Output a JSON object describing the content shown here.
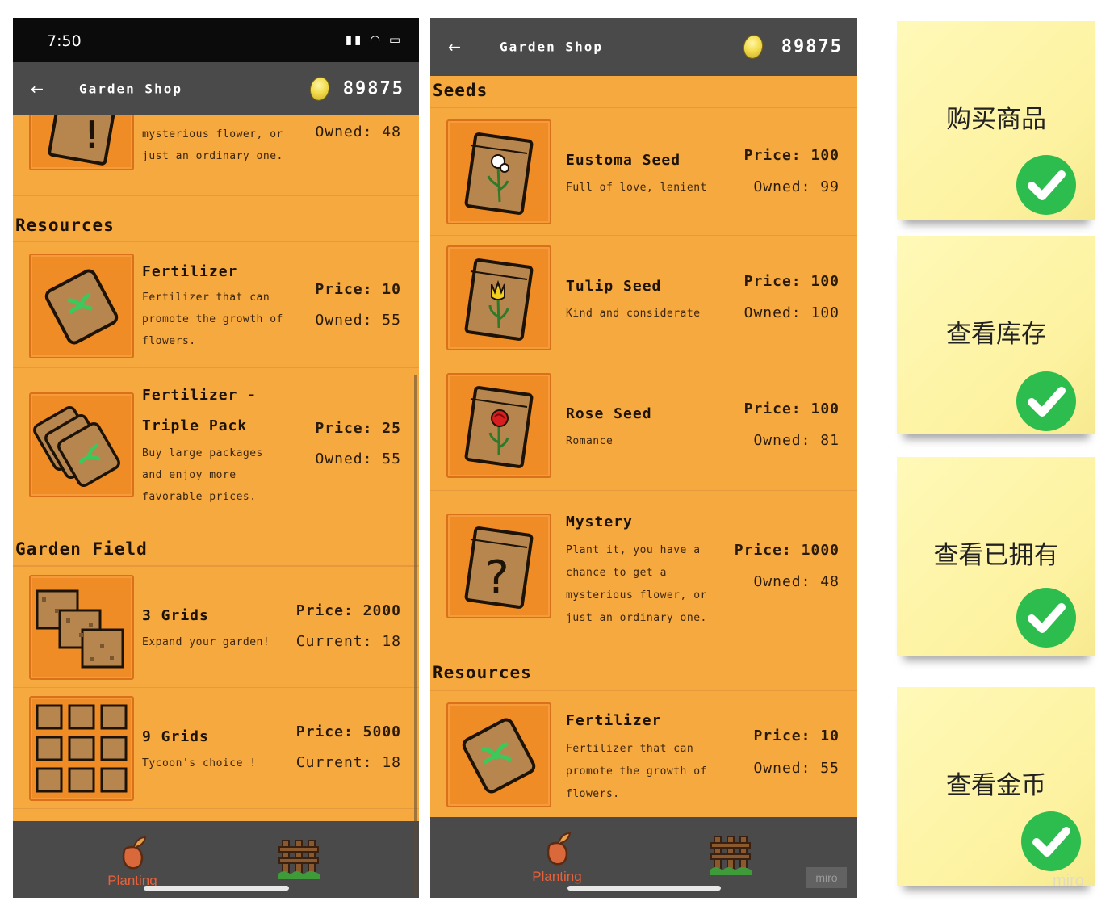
{
  "screen1": {
    "status_time": "7:50",
    "header": {
      "title": "Garden Shop",
      "coins": "89875"
    },
    "partial_item": {
      "desc_lines": [
        "mysterious flower, or",
        "just an ordinary one."
      ],
      "owned": "Owned: 48"
    },
    "sections": {
      "resources": "Resources",
      "garden_field": "Garden Field"
    },
    "items": [
      {
        "name": "Fertilizer",
        "desc_lines": [
          "Fertilizer that can",
          "promote the growth of",
          "flowers."
        ],
        "price": "Price: 10",
        "owned": "Owned: 55"
      },
      {
        "name_lines": [
          "Fertilizer -",
          "Triple Pack"
        ],
        "desc_lines": [
          "Buy large packages",
          "and enjoy more",
          "favorable prices."
        ],
        "price": "Price: 25",
        "owned": "Owned: 55"
      },
      {
        "name": "3 Grids",
        "desc": "Expand your garden!",
        "price": "Price: 2000",
        "owned": "Current: 18"
      },
      {
        "name": "9 Grids",
        "desc": "Tycoon's choice !",
        "price": "Price: 5000",
        "owned": "Current: 18"
      }
    ],
    "nav": {
      "planting": "Planting"
    }
  },
  "screen2": {
    "header": {
      "title": "Garden Shop",
      "coins": "89875"
    },
    "sections": {
      "seeds": "Seeds",
      "resources": "Resources"
    },
    "items": [
      {
        "name": "Eustoma Seed",
        "desc": "Full of love, lenient",
        "price": "Price: 100",
        "owned": "Owned: 99"
      },
      {
        "name": "Tulip Seed",
        "desc": "Kind and considerate",
        "price": "Price: 100",
        "owned": "Owned: 100"
      },
      {
        "name": "Rose Seed",
        "desc": "Romance",
        "price": "Price: 100",
        "owned": "Owned: 81"
      },
      {
        "name": "Mystery",
        "desc_lines": [
          "Plant it, you have a",
          "chance to get a",
          "mysterious flower, or",
          "just an ordinary one."
        ],
        "price": "Price: 1000",
        "owned": "Owned: 48"
      },
      {
        "name": "Fertilizer",
        "desc_lines": [
          "Fertilizer that can",
          "promote the growth of",
          "flowers."
        ],
        "price": "Price: 10",
        "owned": "Owned: 55"
      }
    ],
    "nav": {
      "planting": "Planting"
    },
    "miro_badge": "miro"
  },
  "notes": [
    {
      "label": "购买商品",
      "checked": true
    },
    {
      "label": "查看库存",
      "checked": true
    },
    {
      "label": "查看已拥有",
      "checked": true
    },
    {
      "label": "查看金币",
      "checked": true
    }
  ],
  "watermark": "miro",
  "colors": {
    "shop_bg": "#f5a93e",
    "tile_bg": "#f08c25",
    "appbar": "#4a4a4a",
    "note": "#fdf2a0",
    "check": "#2dbd4e",
    "nav_active": "#e8613a"
  }
}
